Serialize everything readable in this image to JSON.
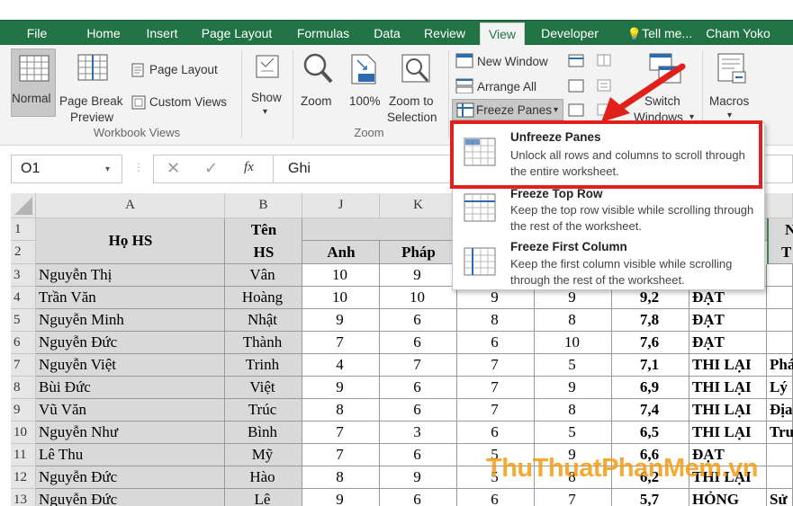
{
  "tabs": [
    "File",
    "Home",
    "Insert",
    "Page Layout",
    "Formulas",
    "Data",
    "Review",
    "View",
    "Developer",
    "Tell me...",
    "Cham Yoko"
  ],
  "ribbon": {
    "normal": "Normal",
    "page_break_1": "Page Break",
    "page_break_2": "Preview",
    "page_layout": "Page Layout",
    "custom_views": "Custom Views",
    "show": "Show",
    "zoom": "Zoom",
    "zoom100": "100%",
    "zoom_sel_1": "Zoom to",
    "zoom_sel_2": "Selection",
    "new_window": "New Window",
    "arrange_all": "Arrange All",
    "freeze_panes": "Freeze Panes",
    "switch_1": "Switch",
    "switch_2": "Windows",
    "macros": "Macros",
    "group_workbook_views": "Workbook Views",
    "group_zoom": "Zoom"
  },
  "formula_bar": {
    "name_box": "O1",
    "fx": "fx",
    "value": "Ghi"
  },
  "dropdown": [
    {
      "title": "Unfreeze Panes",
      "desc": "Unlock all rows and columns to scroll through the entire worksheet."
    },
    {
      "title": "Freeze Top Row",
      "desc": "Keep the top row visible while scrolling through the rest of the worksheet."
    },
    {
      "title": "Freeze First Column",
      "desc": "Keep the first column visible while scrolling through the rest of the worksheet."
    }
  ],
  "columns": [
    "A",
    "B",
    "J",
    "K"
  ],
  "headers": {
    "ho_hs": "Họ HS",
    "ten_hs_1": "Tên",
    "ten_hs_2": "HS",
    "anh": "Anh",
    "phap": "Pháp",
    "n_top": "N",
    "t_right": "T"
  },
  "rows": [
    {
      "num": "3",
      "a": "Nguyễn Thị",
      "b": "Vân",
      "j": "10",
      "k": "9",
      "c1": "",
      "c2": "",
      "avg": "",
      "res": "",
      "sub": ""
    },
    {
      "num": "4",
      "a": "Trần Văn",
      "b": "Hoàng",
      "j": "10",
      "k": "10",
      "c1": "9",
      "c2": "9",
      "avg": "9,2",
      "res": "ĐẠT",
      "sub": ""
    },
    {
      "num": "5",
      "a": "Nguyễn Minh",
      "b": "Nhật",
      "j": "9",
      "k": "6",
      "c1": "8",
      "c2": "8",
      "avg": "7,8",
      "res": "ĐẠT",
      "sub": ""
    },
    {
      "num": "6",
      "a": "Nguyễn Đức",
      "b": "Thành",
      "j": "7",
      "k": "6",
      "c1": "6",
      "c2": "10",
      "avg": "7,6",
      "res": "ĐẠT",
      "sub": ""
    },
    {
      "num": "7",
      "a": "Nguyễn Việt",
      "b": "Trinh",
      "j": "4",
      "k": "7",
      "c1": "7",
      "c2": "5",
      "avg": "7,1",
      "res": "THI LẠI",
      "sub": "Phá"
    },
    {
      "num": "8",
      "a": "Bùi Đức",
      "b": "Việt",
      "j": "9",
      "k": "6",
      "c1": "7",
      "c2": "9",
      "avg": "6,9",
      "res": "THI LẠI",
      "sub": "Lý"
    },
    {
      "num": "9",
      "a": "Vũ Văn",
      "b": "Trúc",
      "j": "8",
      "k": "6",
      "c1": "7",
      "c2": "8",
      "avg": "7,4",
      "res": "THI LẠI",
      "sub": "Địa"
    },
    {
      "num": "10",
      "a": "Nguyễn Như",
      "b": "Bình",
      "j": "7",
      "k": "3",
      "c1": "6",
      "c2": "5",
      "avg": "6,5",
      "res": "THI LẠI",
      "sub": "Tru"
    },
    {
      "num": "11",
      "a": "Lê Thu",
      "b": "Mỹ",
      "j": "7",
      "k": "6",
      "c1": "5",
      "c2": "9",
      "avg": "6,6",
      "res": "ĐẠT",
      "sub": ""
    },
    {
      "num": "12",
      "a": "Nguyễn Đức",
      "b": "Hào",
      "j": "8",
      "k": "9",
      "c1": "5",
      "c2": "8",
      "avg": "6,2",
      "res": "THI LẠI",
      "sub": ""
    },
    {
      "num": "13",
      "a": "Nguyễn Đức",
      "b": "Lê",
      "j": "9",
      "k": "6",
      "c1": "6",
      "c2": "7",
      "avg": "5,7",
      "res": "HỎNG",
      "sub": "Sử"
    }
  ],
  "row_nums_top": [
    "1",
    "2"
  ],
  "watermark": "ThuThuatPhanMem.vn",
  "colors": {
    "excel_green": "#217346",
    "highlight_red": "#e0201b",
    "header_gray": "#d9d9d9"
  }
}
